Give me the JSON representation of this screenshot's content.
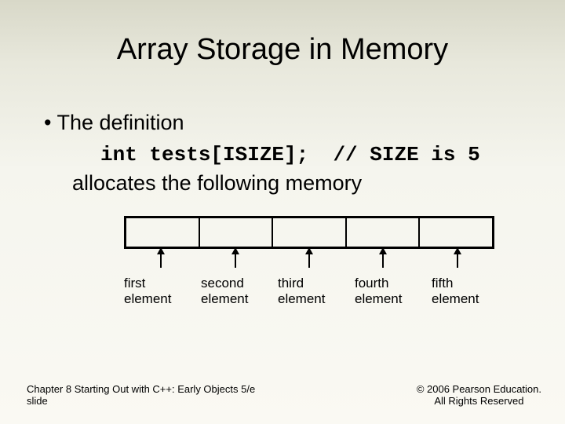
{
  "title": "Array Storage in Memory",
  "bullet": "The definition",
  "code": "int tests[ISIZE];  // SIZE is 5",
  "subline": "allocates the following memory",
  "labels": [
    {
      "l1": "first",
      "l2": "element"
    },
    {
      "l1": "second",
      "l2": "element"
    },
    {
      "l1": "third",
      "l2": "element"
    },
    {
      "l1": "fourth",
      "l2": "element"
    },
    {
      "l1": "fifth",
      "l2": "element"
    }
  ],
  "footer": {
    "left_l1": "Chapter 8 Starting Out with C++: Early Objects 5/e",
    "left_l2": "slide",
    "right_l1": "© 2006 Pearson Education.",
    "right_l2": "All Rights Reserved"
  }
}
